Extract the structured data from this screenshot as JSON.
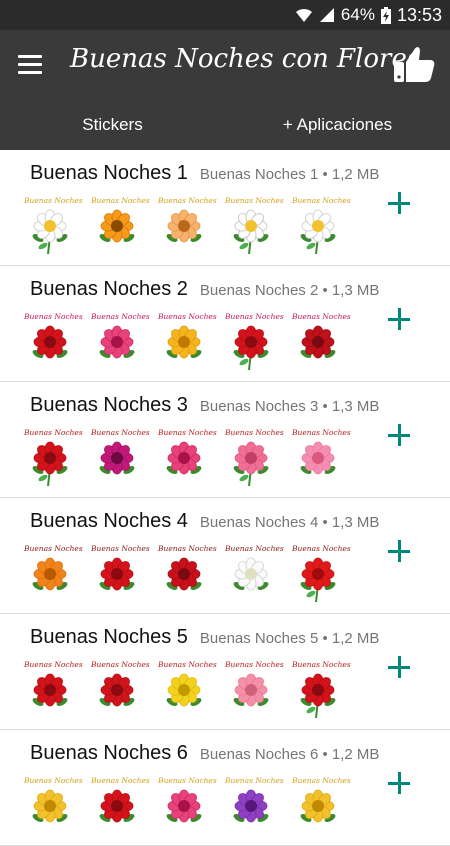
{
  "status_bar": {
    "battery": "64%",
    "time": "13:53"
  },
  "app_bar": {
    "title": "Buenas Noches con Flores"
  },
  "tabs": [
    {
      "label": "Stickers"
    },
    {
      "label": "+ Aplicaciones"
    }
  ],
  "packs": [
    {
      "name": "Buenas Noches 1",
      "meta_name": "Buenas Noches 1",
      "size": "1,2 MB",
      "caption": "Buenas Noches",
      "caption_color": "#d4a017",
      "stickers": [
        "white-daisy",
        "orange-gerbera",
        "peach-gerbera",
        "daisy-bouquet",
        "white-daisy"
      ]
    },
    {
      "name": "Buenas Noches 2",
      "meta_name": "Buenas Noches 2",
      "size": "1,3 MB",
      "caption": "Buenas Noches",
      "caption_color": "#c2185b",
      "stickers": [
        "red-rose",
        "pink-rose",
        "yellow-rose",
        "red-rose-stem",
        "red-rose-bud"
      ]
    },
    {
      "name": "Buenas Noches 3",
      "meta_name": "Buenas Noches 3",
      "size": "1,3 MB",
      "caption": "Buenas Noches",
      "caption_color": "#b71c1c",
      "stickers": [
        "red-rose-stem",
        "petunia",
        "pink-rose",
        "pink-rose-stem",
        "pink-bouquet"
      ]
    },
    {
      "name": "Buenas Noches 4",
      "meta_name": "Buenas Noches 4",
      "size": "1,3 MB",
      "caption": "Buenas Noches",
      "caption_color": "#8b1a1a",
      "stickers": [
        "orange-bouquet",
        "red-rose",
        "red-bouquet",
        "white-rose",
        "red-tulip"
      ]
    },
    {
      "name": "Buenas Noches 5",
      "meta_name": "Buenas Noches 5",
      "size": "1,2 MB",
      "caption": "Buenas Noches",
      "caption_color": "#b71c1c",
      "stickers": [
        "red-rose",
        "red-rose-cluster",
        "yellow-rose-cluster",
        "pink-rose-cluster",
        "red-rose-stem"
      ]
    },
    {
      "name": "Buenas Noches 6",
      "meta_name": "Buenas Noches 6",
      "size": "1,2 MB",
      "caption": "Buenas Noches",
      "caption_color": "#d4a017",
      "stickers": [
        "yellow-flower",
        "red-flower",
        "pink-flower",
        "purple-flower",
        "yellow-flower"
      ]
    }
  ],
  "colors": {
    "appbar": "#3a3a3a",
    "statusbar": "#2b2b2b",
    "accent": "#00897b"
  }
}
